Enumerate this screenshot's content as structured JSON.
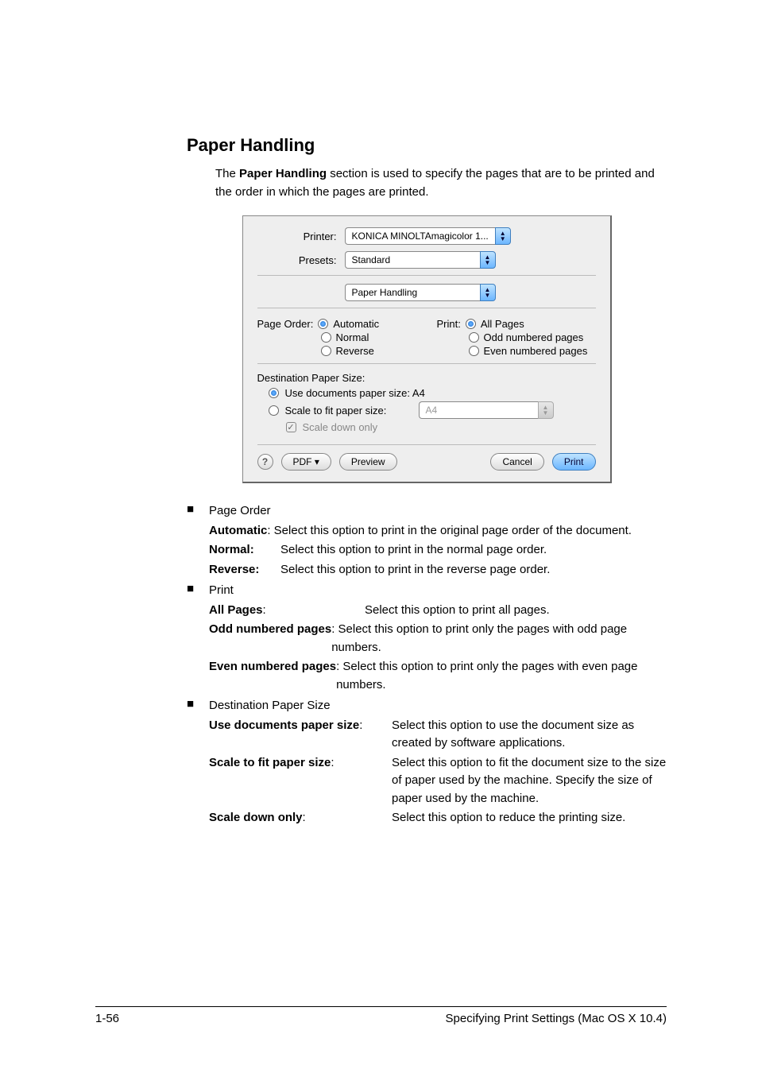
{
  "page": {
    "title": "Paper Handling",
    "intro_prefix": "The ",
    "intro_bold": "Paper Handling",
    "intro_suffix": " section is used to specify the pages that are to be printed and the order in which the pages are printed."
  },
  "dialog": {
    "printer_label": "Printer:",
    "printer_value": "KONICA MINOLTAmagicolor 1...",
    "presets_label": "Presets:",
    "presets_value": "Standard",
    "section_value": "Paper Handling",
    "pageorder": {
      "label": "Page Order:",
      "automatic": "Automatic",
      "normal": "Normal",
      "reverse": "Reverse"
    },
    "print": {
      "label": "Print:",
      "all": "All Pages",
      "odd": "Odd numbered pages",
      "even": "Even numbered pages"
    },
    "dest": {
      "title": "Destination Paper Size:",
      "use_docs_prefix": "Use documents paper size:  ",
      "use_docs_value": "A4",
      "scale_fit": "Scale to fit paper size:",
      "scale_fit_value": "A4",
      "scale_down": "Scale down only"
    },
    "footer": {
      "help": "?",
      "pdf": "PDF ▾",
      "preview": "Preview",
      "cancel": "Cancel",
      "print": "Print"
    }
  },
  "desc": {
    "pageorder": {
      "head": "Page Order",
      "auto_k": "Automatic",
      "auto_v": ": Select this option to print in the original page order of the document.",
      "normal_k": "Normal",
      "normal_v": "Select this option to print in the normal page order.",
      "reverse_k": "Reverse",
      "reverse_v": "Select this option to print in the reverse page order."
    },
    "print": {
      "head": "Print",
      "all_k": "All Pages",
      "all_v": "Select this option to print all pages.",
      "odd_k": "Odd numbered pages",
      "odd_v": ": Select this option to print only the pages with odd page numbers.",
      "even_k": "Even numbered pages",
      "even_v": ": Select this option to print only the pages with even page numbers."
    },
    "dest": {
      "head": "Destination Paper Size",
      "use_k": "Use documents paper size",
      "use_v": "Select this option to use the document size as created by software applications.",
      "scale_k": "Scale to fit paper size",
      "scale_v": "Select this option to fit the document size to the size of paper used by the machine. Specify the size of paper used by the machine.",
      "down_k": "Scale down only",
      "down_v": "Select this option to reduce the printing size."
    }
  },
  "footer": {
    "left": "1-56",
    "right": "Specifying Print Settings (Mac OS X 10.4)"
  }
}
